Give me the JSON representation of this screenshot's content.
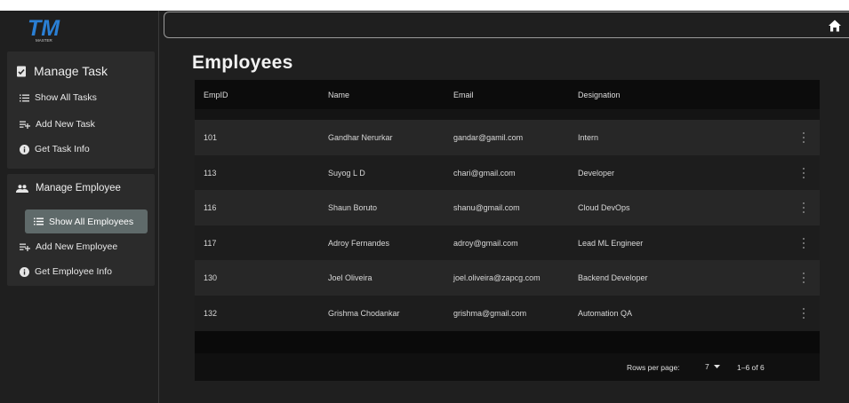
{
  "logo": {
    "text": "TM",
    "subtext": "MASTER"
  },
  "sidebar": {
    "task_section": {
      "title": "Manage Task",
      "items": [
        {
          "label": "Show All Tasks",
          "icon": "list-icon"
        },
        {
          "label": "Add New Task",
          "icon": "playlist-add-icon"
        },
        {
          "label": "Get Task Info",
          "icon": "info-icon"
        }
      ]
    },
    "employee_section": {
      "title": "Manage Employee",
      "items": [
        {
          "label": "Show All Employees",
          "icon": "list-icon",
          "active": true
        },
        {
          "label": "Add New Employee",
          "icon": "playlist-add-icon"
        },
        {
          "label": "Get Employee Info",
          "icon": "info-icon"
        }
      ]
    }
  },
  "header": {
    "home_icon": "home-icon"
  },
  "page": {
    "title": "Employees"
  },
  "table": {
    "columns": [
      "EmpID",
      "Name",
      "Email",
      "Designation"
    ],
    "rows": [
      {
        "id": "101",
        "name": "Gandhar Nerurkar",
        "email": "gandar@gamil.com",
        "designation": "Intern"
      },
      {
        "id": "113",
        "name": "Suyog L D",
        "email": "chari@gmail.com",
        "designation": "Developer"
      },
      {
        "id": "116",
        "name": "Shaun Boruto",
        "email": "shanu@gmail.com",
        "designation": "Cloud DevOps"
      },
      {
        "id": "117",
        "name": "Adroy Fernandes",
        "email": "adroy@gmail.com",
        "designation": "Lead ML Engineer"
      },
      {
        "id": "130",
        "name": "Joel Oliveira",
        "email": "joel.oliveira@zapcg.com",
        "designation": "Backend Developer"
      },
      {
        "id": "132",
        "name": "Grishma Chodankar",
        "email": "grishma@gmail.com",
        "designation": "Automation QA"
      }
    ],
    "footer": {
      "rows_per_page_label": "Rows per page:",
      "rows_per_page_value": "7",
      "range": "1–6 of 6"
    }
  },
  "colors": {
    "accent": "#2a7fd4",
    "active_nav": "#5f6a6a",
    "background": "#1f1f1f"
  }
}
